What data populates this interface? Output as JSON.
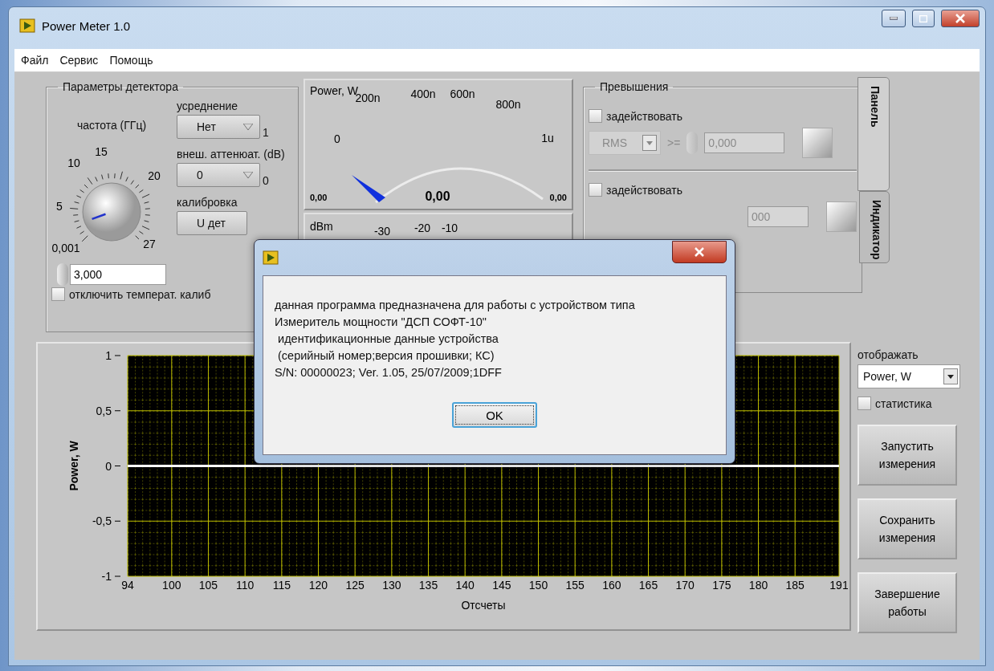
{
  "window": {
    "title": "Power Meter 1.0"
  },
  "menu": [
    {
      "label": "Файл"
    },
    {
      "label": "Сервис"
    },
    {
      "label": "Помощь"
    }
  ],
  "detector": {
    "title": "Параметры детектора",
    "frequency": {
      "label": "частота (ГГц)",
      "scale": [
        "15",
        "10",
        "20",
        "5",
        "27",
        "0,001"
      ],
      "value": "3,000"
    },
    "averaging": {
      "label": "усреднение",
      "value": "Нет",
      "indicator": "1"
    },
    "attenuation": {
      "label": "внеш. аттенюат. (dB)",
      "value": "0",
      "indicator": "0"
    },
    "calibration": {
      "label": "калибровка",
      "value": "U дет"
    },
    "temp_calibration": {
      "label": "отключить температ. калиб",
      "checked": false
    }
  },
  "power_gauge": {
    "label": "Power, W",
    "scale": [
      "0",
      "200n",
      "400n",
      "600n",
      "800n",
      "1u"
    ],
    "min": "0,00",
    "reading": "0,00",
    "max": "0,00"
  },
  "dbm_gauge": {
    "label": "dBm",
    "scale": [
      "-30",
      "-20",
      "-10"
    ]
  },
  "excess": {
    "title": "Превышения",
    "rows": [
      {
        "label": "задействовать",
        "checked": false,
        "mode": "RMS",
        "operator": ">=",
        "value": "0,000"
      },
      {
        "label": "задействовать",
        "checked": false,
        "value": "000"
      }
    ]
  },
  "tabs": [
    {
      "label": "Панель",
      "selected": true
    },
    {
      "label": "Индикатор",
      "selected": false
    }
  ],
  "display": {
    "label": "отображать",
    "value": "Power, W",
    "statistics": {
      "label": "статистика",
      "checked": false
    }
  },
  "buttons": [
    "Запустить измерения",
    "Сохранить измерения",
    "Завершение работы"
  ],
  "graph": {
    "chart_data": {
      "type": "line",
      "grid": true,
      "xlabel": "Отсчеты",
      "ylabel": "Power, W",
      "x": [
        94,
        191
      ],
      "xlim": [
        94,
        191
      ],
      "ylim": [
        -1,
        1
      ],
      "xticks": [
        94,
        100,
        105,
        110,
        115,
        120,
        125,
        130,
        135,
        140,
        145,
        150,
        155,
        160,
        165,
        170,
        175,
        180,
        185,
        191
      ],
      "yticks": [
        {
          "value": 1,
          "label": "1"
        },
        {
          "value": 0.5,
          "label": "0,5"
        },
        {
          "value": 0,
          "label": "0"
        },
        {
          "value": -0.5,
          "label": "-0,5"
        },
        {
          "value": -1,
          "label": "-1"
        }
      ],
      "series": [
        {
          "color": "#ffffff",
          "values": [
            0,
            0
          ]
        }
      ]
    }
  },
  "dialog": {
    "lines": [
      "данная программа предназначена для работы с устройством типа",
      "Измеритель мощности \"ДСП СОФТ-10\"",
      " идентификационные данные устройства",
      " (серийный номер;версия прошивки; КС)",
      "S/N: 00000023; Ver. 1.05, 25/07/2009;1DFF"
    ],
    "button": "OK"
  }
}
